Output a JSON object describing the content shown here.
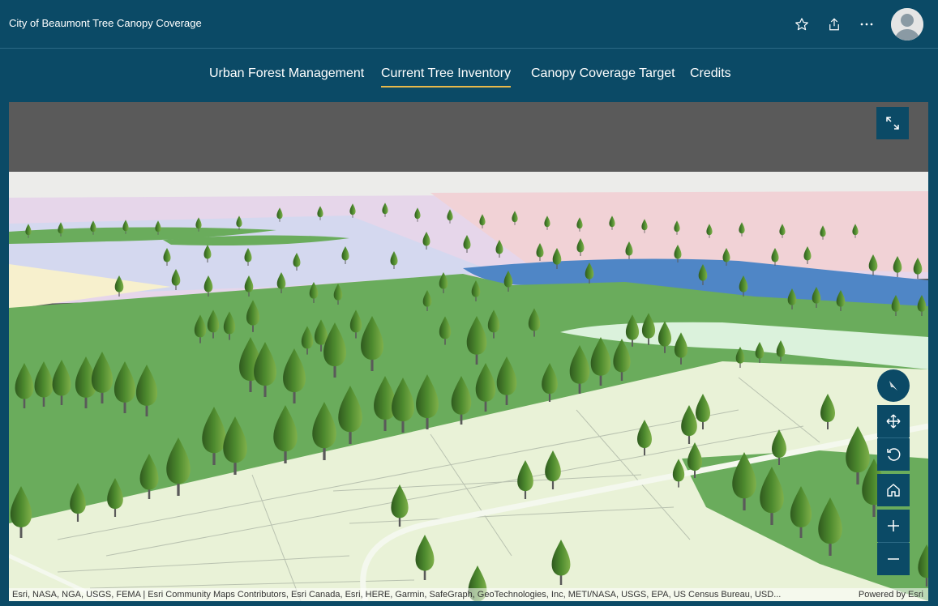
{
  "header": {
    "title": "City of Beaumont Tree Canopy Coverage",
    "icons": [
      "star-icon",
      "share-icon",
      "more-icon",
      "user-avatar"
    ]
  },
  "nav": {
    "tabs": [
      {
        "label": "Urban Forest Management",
        "active": false
      },
      {
        "label": "Current Tree Inventory",
        "active": true
      },
      {
        "label": "Canopy Coverage Target",
        "active": false
      },
      {
        "label": "Credits",
        "active": false
      }
    ]
  },
  "map": {
    "controls": [
      "fullscreen-icon",
      "compass-icon",
      "pan-icon",
      "rotate-icon",
      "home-icon",
      "zoom-in-icon",
      "zoom-out-icon"
    ],
    "attribution": "Esri, NASA, NGA, USGS, FEMA | Esri Community Maps Contributors, Esri Canada, Esri, HERE, Garmin, SafeGraph, GeoTechnologies, Inc, METI/NASA, USGS, EPA, US Census Bureau, USD...",
    "powered_by": "Powered by Esri"
  },
  "colors": {
    "header_bg": "#0b4a66",
    "active_tab_underline": "#e9b94a",
    "grass": "#6aac5c",
    "water": "#4f86c6",
    "sky": "#5a5a5a"
  }
}
